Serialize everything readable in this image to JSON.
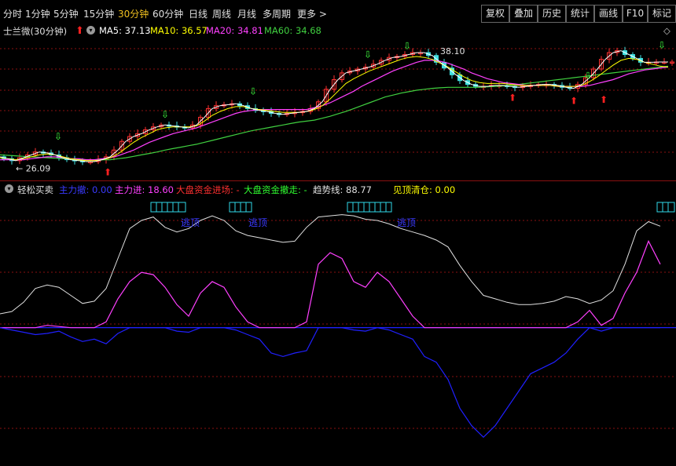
{
  "toolbar": {
    "periods": [
      "分时",
      "1分钟",
      "5分钟",
      "15分钟",
      "30分钟",
      "60分钟",
      "日线",
      "周线",
      "月线",
      "多周期",
      "更多"
    ],
    "active_period": "30分钟",
    "right_buttons": [
      "复权",
      "叠加",
      "历史",
      "统计",
      "画线",
      "F10",
      "标记"
    ]
  },
  "main": {
    "stock_title": "士兰微(30分钟)",
    "ma": [
      {
        "label": "MA5: 37.13",
        "color": "#ffffff"
      },
      {
        "label": "MA10: 36.57",
        "color": "#ffff00"
      },
      {
        "label": "MA20: 34.81",
        "color": "#ff40ff"
      },
      {
        "label": "MA60: 34.68",
        "color": "#40d040"
      }
    ],
    "high_label": "38.10",
    "low_label": "26.09"
  },
  "indicator": {
    "name": "轻松买卖",
    "fields": [
      {
        "label": "主力撤: 0.00",
        "color": "#3a3aff"
      },
      {
        "label": "主力进: 18.60",
        "color": "#ff40ff"
      },
      {
        "label": "大盘资金进场: -",
        "color": "#ff3030"
      },
      {
        "label": "大盘资金撤走: -",
        "color": "#30ff30"
      },
      {
        "label": "趋势线: 88.77",
        "color": "#e0e0e0"
      },
      {
        "label": "见顶清仓: 0.00",
        "color": "#ffff00"
      }
    ],
    "top_label": "逃顶"
  },
  "colors": {
    "up": "#ff3030",
    "down": "#40e0e0",
    "grid": "#8a1010",
    "white_line": "#e0e0e0",
    "magenta": "#ff40ff",
    "blue": "#2020ff",
    "cyan": "#30d8e8"
  },
  "chart_data": {
    "type": "line",
    "price_series": {
      "x": [
        0,
        10,
        20,
        30,
        40,
        50,
        60,
        70,
        80,
        90,
        100,
        110,
        120,
        130,
        140,
        150,
        160,
        170,
        180,
        190,
        200,
        210,
        220,
        230,
        240,
        250,
        260,
        270,
        280,
        290,
        300,
        310,
        320,
        330,
        340,
        350,
        360,
        370,
        380,
        390,
        400,
        410,
        420,
        430,
        440,
        450,
        460,
        470,
        480,
        490,
        500,
        510,
        520,
        530,
        540,
        550,
        560,
        570,
        580,
        590,
        600,
        610,
        620,
        630,
        640,
        650,
        660,
        670,
        680,
        690,
        700,
        710,
        720,
        730,
        740,
        750,
        760,
        770,
        780,
        790,
        800,
        810,
        820,
        830,
        840,
        850,
        860
      ],
      "ma5": [
        27.3,
        27.1,
        26.9,
        27.2,
        27.5,
        27.8,
        27.7,
        27.5,
        27.2,
        27.0,
        26.9,
        26.8,
        26.8,
        27.0,
        27.3,
        28.0,
        28.9,
        29.4,
        29.7,
        30.1,
        30.4,
        30.6,
        30.5,
        30.4,
        30.3,
        30.6,
        31.4,
        32.3,
        32.6,
        32.7,
        32.8,
        32.6,
        32.3,
        32.1,
        32.0,
        31.8,
        31.7,
        31.8,
        31.9,
        32.0,
        32.3,
        33.0,
        34.3,
        35.3,
        36.0,
        36.2,
        36.4,
        36.6,
        36.9,
        37.3,
        37.6,
        37.7,
        37.9,
        38.1,
        38.1,
        37.8,
        37.1,
        36.5,
        35.8,
        35.2,
        34.8,
        34.6,
        34.6,
        34.7,
        34.7,
        34.6,
        34.5,
        34.6,
        34.7,
        34.8,
        34.8,
        34.7,
        34.5,
        34.4,
        34.8,
        35.5,
        36.4,
        37.4,
        38.1,
        38.3,
        37.9,
        37.5,
        37.1,
        37.1,
        37.13,
        37.13,
        37.13
      ],
      "ma10": [
        27.2,
        27.1,
        27.0,
        27.1,
        27.3,
        27.5,
        27.6,
        27.5,
        27.3,
        27.1,
        27.0,
        26.9,
        26.9,
        27.0,
        27.2,
        27.6,
        28.2,
        28.8,
        29.3,
        29.7,
        30.1,
        30.3,
        30.4,
        30.4,
        30.4,
        30.5,
        31.0,
        31.6,
        32.0,
        32.3,
        32.5,
        32.5,
        32.3,
        32.2,
        32.1,
        32.0,
        31.9,
        31.9,
        31.9,
        32.0,
        32.2,
        32.6,
        33.3,
        34.1,
        34.9,
        35.4,
        35.8,
        36.2,
        36.5,
        36.8,
        37.1,
        37.4,
        37.6,
        37.7,
        37.6,
        37.4,
        37.0,
        36.6,
        36.1,
        35.6,
        35.2,
        35.0,
        34.9,
        34.9,
        34.9,
        34.8,
        34.7,
        34.7,
        34.7,
        34.7,
        34.7,
        34.6,
        34.6,
        34.6,
        34.7,
        35.1,
        35.6,
        36.2,
        36.8,
        37.3,
        37.5,
        37.4,
        37.1,
        36.9,
        36.7,
        36.6,
        36.57
      ],
      "ma20": [
        27.0,
        27.0,
        27.0,
        27.0,
        27.1,
        27.2,
        27.3,
        27.3,
        27.2,
        27.1,
        27.1,
        27.0,
        27.0,
        27.1,
        27.2,
        27.4,
        27.7,
        28.0,
        28.4,
        28.8,
        29.1,
        29.4,
        29.7,
        29.9,
        30.1,
        30.3,
        30.6,
        30.9,
        31.2,
        31.5,
        31.8,
        32.0,
        32.1,
        32.2,
        32.2,
        32.2,
        32.2,
        32.2,
        32.2,
        32.2,
        32.4,
        32.6,
        32.9,
        33.3,
        33.7,
        34.1,
        34.6,
        35.0,
        35.4,
        35.8,
        36.2,
        36.5,
        36.8,
        37.1,
        37.3,
        37.3,
        37.2,
        37.0,
        36.7,
        36.4,
        36.0,
        35.7,
        35.4,
        35.2,
        35.0,
        34.9,
        34.8,
        34.7,
        34.7,
        34.7,
        34.7,
        34.6,
        34.6,
        34.6,
        34.6,
        34.7,
        34.9,
        35.1,
        35.3,
        35.6,
        35.9,
        36.1,
        36.3,
        36.4,
        36.5,
        36.6,
        34.81
      ],
      "ma60": [
        27.5,
        27.45,
        27.4,
        27.35,
        27.3,
        27.25,
        27.2,
        27.15,
        27.1,
        27.05,
        27.0,
        27.0,
        27.0,
        27.0,
        27.0,
        27.1,
        27.2,
        27.35,
        27.5,
        27.65,
        27.8,
        28.0,
        28.15,
        28.3,
        28.45,
        28.6,
        28.8,
        29.0,
        29.2,
        29.4,
        29.6,
        29.8,
        30.0,
        30.15,
        30.3,
        30.45,
        30.6,
        30.75,
        30.9,
        31.0,
        31.1,
        31.3,
        31.5,
        31.75,
        32.0,
        32.3,
        32.6,
        32.9,
        33.2,
        33.5,
        33.7,
        33.9,
        34.05,
        34.2,
        34.3,
        34.4,
        34.45,
        34.5,
        34.5,
        34.5,
        34.5,
        34.5,
        34.55,
        34.6,
        34.65,
        34.7,
        34.8,
        34.9,
        35.0,
        35.1,
        35.2,
        35.3,
        35.4,
        35.5,
        35.6,
        35.7,
        35.8,
        35.9,
        36.0,
        36.1,
        36.2,
        36.3,
        36.4,
        36.5,
        36.6,
        36.7,
        34.68
      ]
    },
    "indicator_series": {
      "x": [
        0,
        15,
        30,
        45,
        60,
        75,
        90,
        105,
        120,
        135,
        150,
        165,
        180,
        195,
        210,
        225,
        240,
        255,
        270,
        285,
        300,
        315,
        330,
        345,
        360,
        375,
        390,
        405,
        420,
        435,
        450,
        465,
        480,
        495,
        510,
        525,
        540,
        555,
        570,
        585,
        600,
        615,
        630,
        645,
        660,
        675,
        690,
        705,
        720,
        735,
        750,
        765,
        780,
        795,
        810,
        825,
        840,
        855
      ],
      "trend": [
        12,
        14,
        22,
        34,
        37,
        35,
        28,
        21,
        23,
        34,
        60,
        86,
        93,
        96,
        87,
        83,
        86,
        93,
        97,
        93,
        84,
        80,
        78,
        76,
        74,
        75,
        87,
        96,
        97,
        98,
        97,
        94,
        93,
        90,
        86,
        83,
        80,
        76,
        70,
        54,
        40,
        28,
        25,
        22,
        20,
        20,
        21,
        23,
        27,
        25,
        21,
        24,
        32,
        55,
        84,
        92,
        88
      ],
      "power": [
        0,
        0,
        0,
        0,
        2,
        1,
        0,
        0,
        0,
        5,
        25,
        40,
        48,
        46,
        35,
        20,
        10,
        30,
        40,
        35,
        18,
        5,
        0,
        0,
        0,
        0,
        5,
        55,
        65,
        60,
        40,
        35,
        48,
        40,
        25,
        10,
        0,
        0,
        0,
        0,
        0,
        0,
        0,
        0,
        0,
        0,
        0,
        0,
        0,
        5,
        15,
        2,
        8,
        30,
        48,
        75,
        55
      ],
      "retreat": [
        0,
        -2,
        -4,
        -6,
        -5,
        -3,
        -8,
        -12,
        -10,
        -14,
        -5,
        0,
        0,
        0,
        0,
        -3,
        -4,
        0,
        0,
        0,
        -2,
        -6,
        -10,
        -22,
        -25,
        -22,
        -20,
        0,
        0,
        0,
        -2,
        -3,
        0,
        -2,
        -6,
        -10,
        -25,
        -30,
        -45,
        -70,
        -85,
        -95,
        -85,
        -70,
        -55,
        -40,
        -35,
        -30,
        -22,
        -10,
        0,
        -3,
        0,
        0,
        0,
        0,
        0
      ]
    }
  }
}
